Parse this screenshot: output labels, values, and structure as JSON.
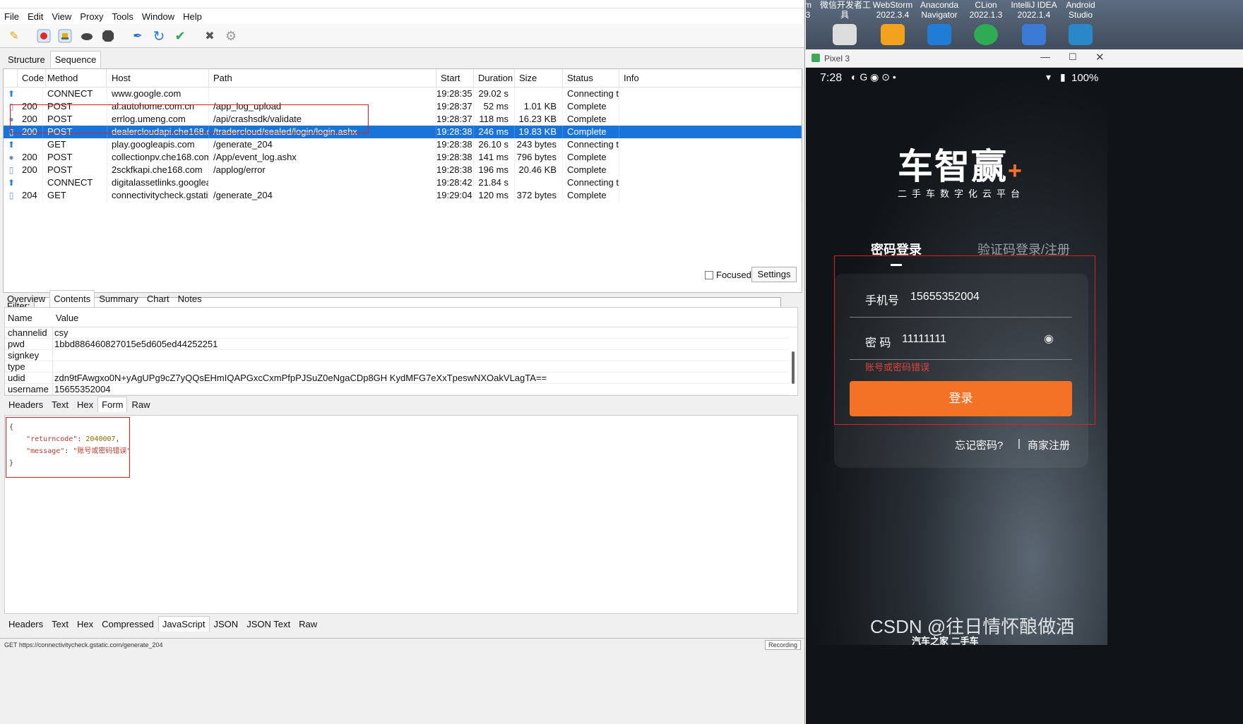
{
  "menu": [
    "File",
    "Edit",
    "View",
    "Proxy",
    "Tools",
    "Window",
    "Help"
  ],
  "toolbar_icons": [
    "broom-icon",
    "record-icon",
    "throttle-icon",
    "turtle-icon",
    "stop-icon",
    "pen-icon",
    "refresh-icon",
    "check-icon",
    "tools-icon",
    "settings-gear-icon"
  ],
  "view_tabs": [
    "Structure",
    "Sequence"
  ],
  "columns": [
    "Code",
    "Method",
    "Host",
    "Path",
    "Start",
    "Duration",
    "Size",
    "Status",
    "Info"
  ],
  "rows": [
    {
      "icon": "up-arrow-icon",
      "code": "",
      "method": "CONNECT",
      "host": "www.google.com",
      "path": "",
      "start": "19:28:35",
      "duration": "29.02 s",
      "size": "",
      "status": "Connecting t...",
      "selected": false
    },
    {
      "icon": "doc-icon",
      "code": "200",
      "method": "POST",
      "host": "al.autohome.com.cn",
      "path": "/app_log_upload",
      "start": "19:28:37",
      "duration": "52 ms",
      "size": "1.01 KB",
      "status": "Complete",
      "selected": false
    },
    {
      "icon": "dot-icon",
      "code": "200",
      "method": "POST",
      "host": "errlog.umeng.com",
      "path": "/api/crashsdk/validate",
      "start": "19:28:37",
      "duration": "118 ms",
      "size": "16.23 KB",
      "status": "Complete",
      "selected": false
    },
    {
      "icon": "doc-icon",
      "code": "200",
      "method": "POST",
      "host": "dealercloudapi.che168.c...",
      "path": "/tradercloud/sealed/login/login.ashx",
      "start": "19:28:38",
      "duration": "246 ms",
      "size": "19.83 KB",
      "status": "Complete",
      "selected": true
    },
    {
      "icon": "up-arrow-icon",
      "code": "",
      "method": "GET",
      "host": "play.googleapis.com",
      "path": "/generate_204",
      "start": "19:28:38",
      "duration": "26.10 s",
      "size": "243 bytes",
      "status": "Connecting t...",
      "selected": false
    },
    {
      "icon": "dot-icon",
      "code": "200",
      "method": "POST",
      "host": "collectionpv.che168.com",
      "path": "/App/event_log.ashx",
      "start": "19:28:38",
      "duration": "141 ms",
      "size": "796 bytes",
      "status": "Complete",
      "selected": false
    },
    {
      "icon": "doc-icon",
      "code": "200",
      "method": "POST",
      "host": "2sckfkapi.che168.com",
      "path": "/applog/error",
      "start": "19:28:38",
      "duration": "196 ms",
      "size": "20.46 KB",
      "status": "Complete",
      "selected": false
    },
    {
      "icon": "up-arrow-icon",
      "code": "",
      "method": "CONNECT",
      "host": "digitalassetlinks.googlea...",
      "path": "",
      "start": "19:28:42",
      "duration": "21.84 s",
      "size": "",
      "status": "Connecting t...",
      "selected": false
    },
    {
      "icon": "doc-icon",
      "code": "204",
      "method": "GET",
      "host": "connectivitycheck.gstatic...",
      "path": "/generate_204",
      "start": "19:29:04",
      "duration": "120 ms",
      "size": "372 bytes",
      "status": "Complete",
      "selected": false
    }
  ],
  "filter": {
    "label": "Filter:",
    "value": "",
    "focused_label": "Focused",
    "settings_label": "Settings"
  },
  "detail_tabs": [
    "Overview",
    "Contents",
    "Summary",
    "Chart",
    "Notes"
  ],
  "form": {
    "name_header": "Name",
    "value_header": "Value",
    "rows": [
      {
        "name": "channelid",
        "value": "csy"
      },
      {
        "name": "pwd",
        "value": "1bbd886460827015e5d605ed44252251"
      },
      {
        "name": "signkey",
        "value": ""
      },
      {
        "name": "type",
        "value": ""
      },
      {
        "name": "udid",
        "value": "zdn9tFAwgxo0N+yAgUPg9cZ7yQQsEHmIQAPGxcCxmPfpPJSuZ0eNgaCDp8GH KydMFG7eXxTpeswNXOakVLagTA=="
      },
      {
        "name": "username",
        "value": "15655352004"
      }
    ]
  },
  "request_subtabs": [
    "Headers",
    "Text",
    "Hex",
    "Form",
    "Raw"
  ],
  "response_json": {
    "open": "{",
    "k1": "\"returncode\"",
    "v1": "2040007",
    "k2": "\"message\"",
    "v2": "\"账号或密码错误\"",
    "close": "}"
  },
  "response_subtabs": [
    "Headers",
    "Text",
    "Hex",
    "Compressed",
    "JavaScript",
    "JSON",
    "JSON Text",
    "Raw"
  ],
  "status_bar": {
    "left": "GET https://connectivitycheck.gstatic.com/generate_204",
    "right": "Recording"
  },
  "desktop_icons": [
    {
      "label": "m\n3"
    },
    {
      "label": "微信开发者工\n具"
    },
    {
      "label": "WebStorm\n2022.3.4"
    },
    {
      "label": "Anaconda\nNavigator"
    },
    {
      "label": "CLion\n2022.1.3"
    },
    {
      "label": "IntelliJ IDEA\n2022.1.4"
    },
    {
      "label": "Android\nStudio"
    }
  ],
  "emulator": {
    "title": "Pixel 3",
    "time": "7:28",
    "battery": "100%",
    "logo_main": "车智赢",
    "logo_plus": "+",
    "logo_sub": "二手车数字化云平台",
    "tab_password": "密码登录",
    "tab_sms": "验证码登录/注册",
    "phone_label": "手机号",
    "phone_value": "15655352004",
    "pwd_label": "密 码",
    "pwd_value": "11111111",
    "error_text": "账号或密码错误",
    "login_button": "登录",
    "forgot": "忘记密码?",
    "separator": "|",
    "merchant_register": "商家注册",
    "brand_watermark": "汽车之家 二手车"
  },
  "watermark": "CSDN @往日情怀酿做酒"
}
